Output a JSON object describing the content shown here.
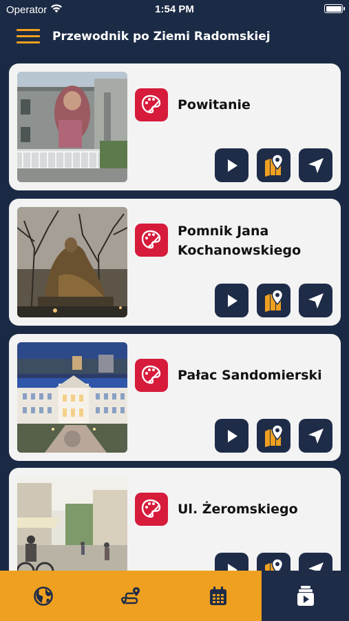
{
  "status_bar": {
    "carrier": "Operator",
    "time": "1:54 PM"
  },
  "header": {
    "title": "Przewodnik po Ziemi Radomskiej"
  },
  "items": [
    {
      "title": "Powitanie",
      "category_icon": "palette-icon"
    },
    {
      "title": "Pomnik Jana Kochanowskiego",
      "category_icon": "palette-icon"
    },
    {
      "title": "Pałac Sandomierski",
      "category_icon": "palette-icon"
    },
    {
      "title": "Ul. Żeromskiego",
      "category_icon": "palette-icon"
    }
  ],
  "item_actions": [
    "play-icon",
    "map-pin-icon",
    "navigate-arrow-icon"
  ],
  "tabs": [
    {
      "icon": "globe-icon",
      "active": false
    },
    {
      "icon": "route-icon",
      "active": false
    },
    {
      "icon": "calendar-icon",
      "active": false
    },
    {
      "icon": "audio-guide-icon",
      "active": true
    }
  ],
  "colors": {
    "background": "#1c2b45",
    "accent": "#efa020",
    "category": "#d61b3b",
    "card": "#f3f3f3"
  }
}
